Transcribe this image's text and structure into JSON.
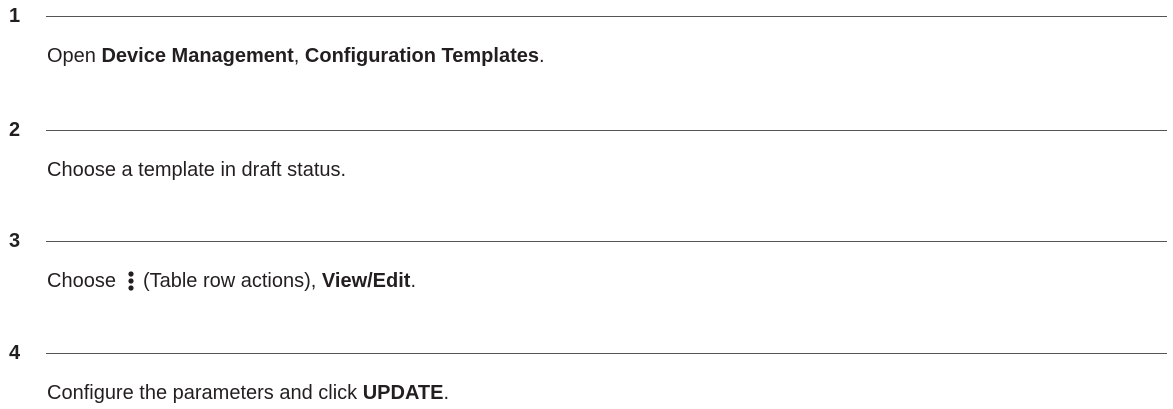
{
  "steps": [
    {
      "number": "1",
      "text_before": "Open ",
      "bold_1": "Device Management",
      "separator": ", ",
      "bold_2": "Configuration Templates",
      "text_after": "."
    },
    {
      "number": "2",
      "text": "Choose a template in draft status."
    },
    {
      "number": "3",
      "text_before": "Choose",
      "icon": "vertical-ellipsis-icon",
      "icon_caption": "(Table row actions), ",
      "bold_1": "View/Edit",
      "text_after": "."
    },
    {
      "number": "4",
      "text_before": "Configure the parameters and click ",
      "bold_1": "UPDATE",
      "text_after": "."
    }
  ]
}
